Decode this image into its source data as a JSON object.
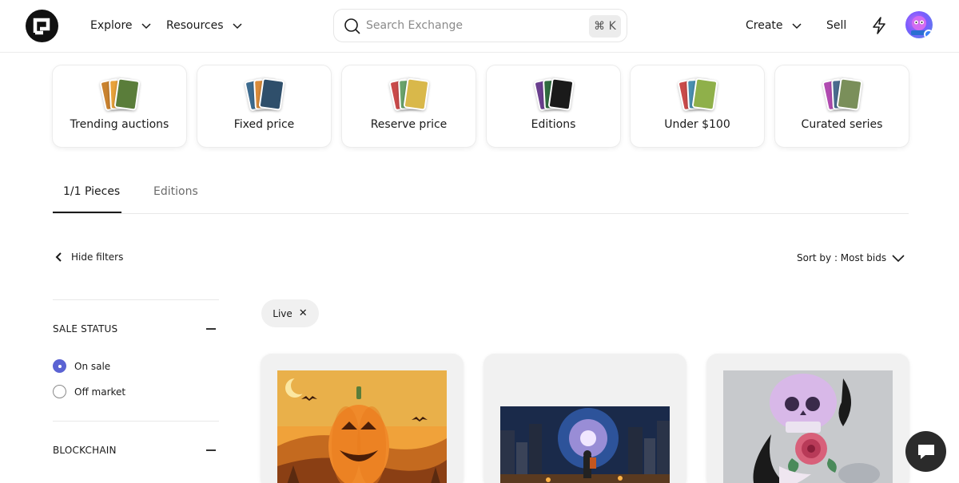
{
  "header": {
    "nav": [
      {
        "label": "Explore"
      },
      {
        "label": "Resources"
      }
    ],
    "search": {
      "placeholder": "Search Exchange",
      "shortcut": "⌘ K"
    },
    "create_label": "Create",
    "sell_label": "Sell"
  },
  "categories": [
    {
      "label": "Trending auctions",
      "colors": [
        "#c9822f",
        "#e8a23b",
        "#5a7d3a"
      ]
    },
    {
      "label": "Fixed price",
      "colors": [
        "#3d6b8f",
        "#d98b3a",
        "#2f4f6b"
      ]
    },
    {
      "label": "Reserve price",
      "colors": [
        "#c94a4a",
        "#6aa36b",
        "#d9b84a"
      ]
    },
    {
      "label": "Editions",
      "colors": [
        "#6a3f8f",
        "#2f6b3f",
        "#1a1a1a"
      ]
    },
    {
      "label": "Under $100",
      "colors": [
        "#c94a4a",
        "#4a8fb0",
        "#8fb04a"
      ]
    },
    {
      "label": "Curated series",
      "colors": [
        "#b04ab0",
        "#4a6b8f",
        "#7a8f5a"
      ]
    }
  ],
  "tabs": [
    {
      "label": "1/1 Pieces",
      "active": true
    },
    {
      "label": "Editions",
      "active": false
    }
  ],
  "filters": {
    "hide_label": "Hide filters",
    "sort_label": "Sort by : Most bids",
    "active_chip": "Live",
    "sections": [
      {
        "title": "SALE STATUS",
        "options": [
          {
            "label": "On sale",
            "checked": true
          },
          {
            "label": "Off market",
            "checked": false
          }
        ]
      },
      {
        "title": "BLOCKCHAIN"
      }
    ]
  },
  "colors": {
    "accent": "#5b63d3",
    "text": "#1a1a1a",
    "chat_bg": "#2b2b2b"
  }
}
